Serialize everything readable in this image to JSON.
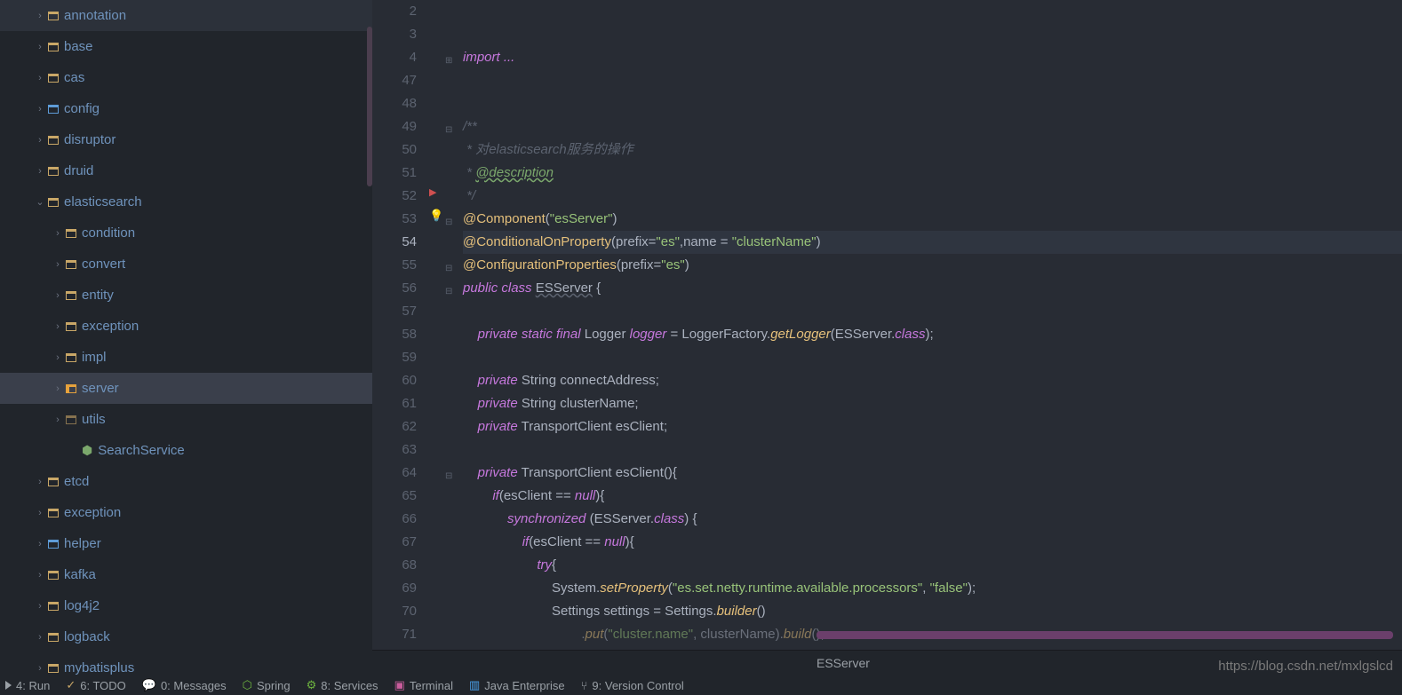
{
  "tree": [
    {
      "label": "annotation",
      "ind": 0,
      "chev": "›",
      "icon": "folder"
    },
    {
      "label": "base",
      "ind": 0,
      "chev": "›",
      "icon": "folder"
    },
    {
      "label": "cas",
      "ind": 0,
      "chev": "›",
      "icon": "folder"
    },
    {
      "label": "config",
      "ind": 0,
      "chev": "›",
      "icon": "folder-special"
    },
    {
      "label": "disruptor",
      "ind": 0,
      "chev": "›",
      "icon": "folder"
    },
    {
      "label": "druid",
      "ind": 0,
      "chev": "›",
      "icon": "folder"
    },
    {
      "label": "elasticsearch",
      "ind": 0,
      "chev": "⌄",
      "icon": "folder-open"
    },
    {
      "label": "condition",
      "ind": 1,
      "chev": "›",
      "icon": "folder"
    },
    {
      "label": "convert",
      "ind": 1,
      "chev": "›",
      "icon": "folder"
    },
    {
      "label": "entity",
      "ind": 1,
      "chev": "›",
      "icon": "folder"
    },
    {
      "label": "exception",
      "ind": 1,
      "chev": "›",
      "icon": "folder"
    },
    {
      "label": "impl",
      "ind": 1,
      "chev": "›",
      "icon": "folder"
    },
    {
      "label": "server",
      "ind": 1,
      "chev": "›",
      "icon": "folder-sel",
      "selected": true
    },
    {
      "label": "utils",
      "ind": 1,
      "chev": "›",
      "icon": "folder-dark"
    },
    {
      "label": "SearchService",
      "ind": 2,
      "chev": "",
      "icon": "interface"
    },
    {
      "label": "etcd",
      "ind": 0,
      "chev": "›",
      "icon": "folder"
    },
    {
      "label": "exception",
      "ind": 0,
      "chev": "›",
      "icon": "folder"
    },
    {
      "label": "helper",
      "ind": 0,
      "chev": "›",
      "icon": "folder-special"
    },
    {
      "label": "kafka",
      "ind": 0,
      "chev": "›",
      "icon": "folder"
    },
    {
      "label": "log4j2",
      "ind": 0,
      "chev": "›",
      "icon": "folder"
    },
    {
      "label": "logback",
      "ind": 0,
      "chev": "›",
      "icon": "folder"
    },
    {
      "label": "mybatisplus",
      "ind": 0,
      "chev": "›",
      "icon": "folder"
    }
  ],
  "lineNumbers": [
    "2",
    "3",
    "4",
    "47",
    "48",
    "49",
    "50",
    "51",
    "52",
    "53",
    "54",
    "55",
    "56",
    "57",
    "58",
    "59",
    "60",
    "61",
    "62",
    "63",
    "64",
    "65",
    "66",
    "67",
    "68",
    "69",
    "70",
    "71"
  ],
  "currentLine": "54",
  "code": {
    "l4": "import ...",
    "l49": "/**",
    "l50_a": " * 对",
    "l50_b": "elasticsearch",
    "l50_c": "服务的操作",
    "l51_a": " * ",
    "l51_b": "@description",
    "l52": " */",
    "l53_ann": "@Component",
    "l53_str": "\"esServer\"",
    "l54_ann": "@ConditionalOnProperty",
    "l54_a": "(prefix=",
    "l54_s1": "\"es\"",
    "l54_b": ",name = ",
    "l54_s2": "\"clusterName\"",
    "l54_c": ")",
    "l55_ann": "@ConfigurationProperties",
    "l55_a": "(prefix=",
    "l55_s": "\"es\"",
    "l55_b": ")",
    "l56_a": "public",
    "l56_b": " class ",
    "l56_c": "ESServer",
    "l56_d": " {",
    "l58_a": "private",
    "l58_b": " static final ",
    "l58_c": "Logger ",
    "l58_d": "logger",
    "l58_e": " = LoggerFactory.",
    "l58_f": "getLogger",
    "l58_g": "(ESServer.",
    "l58_h": "class",
    "l58_i": ");",
    "l60_a": "private",
    "l60_b": " String connectAddress;",
    "l61_a": "private",
    "l61_b": " String clusterName;",
    "l62_a": "private",
    "l62_b": " TransportClient esClient;",
    "l64_a": "private",
    "l64_b": " TransportClient esClient(){",
    "l65_a": "if",
    "l65_b": "(esClient == ",
    "l65_c": "null",
    "l65_d": "){",
    "l66_a": "synchronized",
    "l66_b": " (ESServer.",
    "l66_c": "class",
    "l66_d": ") {",
    "l67_a": "if",
    "l67_b": "(esClient == ",
    "l67_c": "null",
    "l67_d": "){",
    "l68_a": "try",
    "l68_b": "{",
    "l69_a": "System.",
    "l69_b": "setProperty",
    "l69_c": "(",
    "l69_s1": "\"es.set.netty.runtime.available.processors\"",
    "l69_d": ", ",
    "l69_s2": "\"false\"",
    "l69_e": ");",
    "l70_a": "Settings settings = Settings.",
    "l70_b": "builder",
    "l70_c": "()",
    "l71_a": ".",
    "l71_b": "put",
    "l71_c": "(",
    "l71_s": "\"cluster.name\"",
    "l71_d": ", clusterName).",
    "l71_e": "build",
    "l71_f": "();"
  },
  "breadcrumb": "ESServer",
  "bottomBar": {
    "run": "4: Run",
    "todo": "6: TODO",
    "messages": "0: Messages",
    "spring": "Spring",
    "services": "8: Services",
    "terminal": "Terminal",
    "javaee": "Java Enterprise",
    "vc": "9: Version Control"
  },
  "watermark": "https://blog.csdn.net/mxlgslcd"
}
